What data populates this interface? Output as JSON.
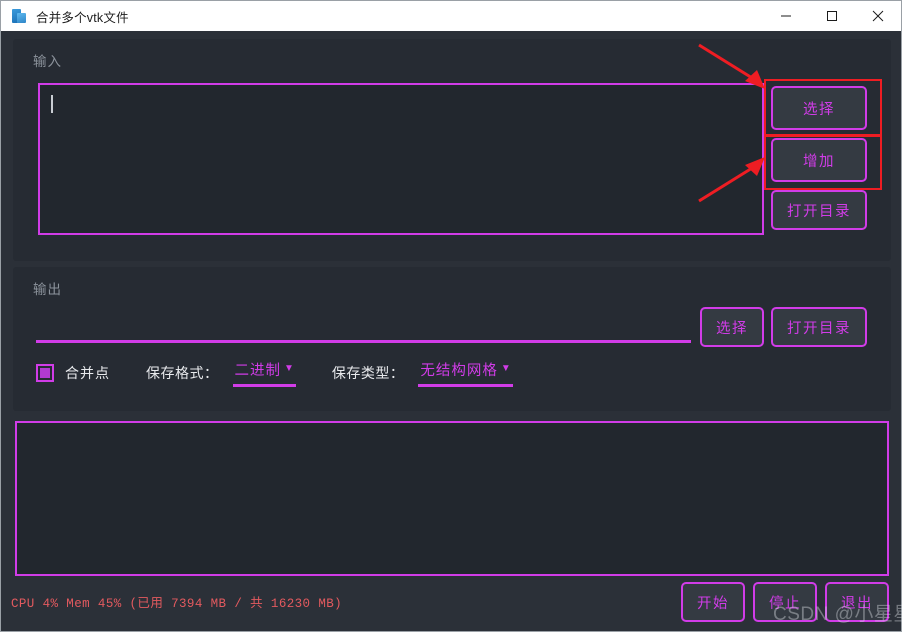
{
  "window": {
    "title": "合并多个vtk文件",
    "icon": "vtk-app-icon",
    "controls": {
      "minimize": "minimize-icon",
      "maximize": "maximize-icon",
      "close": "close-icon"
    }
  },
  "colors": {
    "accent": "#d13ce8",
    "annotation": "#ee1d23",
    "status_text": "#e35a5f",
    "panel_bg": "#262b33",
    "window_bg": "#2b3038",
    "field_bg": "#22272e"
  },
  "input_section": {
    "label": "输入",
    "textarea_value": "",
    "buttons": {
      "select": "选择",
      "add": "增加",
      "open_dir": "打开目录"
    }
  },
  "output_section": {
    "label": "输出",
    "path_value": "",
    "buttons": {
      "select": "选择",
      "open_dir": "打开目录"
    },
    "merge_points": {
      "label": "合并点",
      "checked": true
    },
    "save_format": {
      "label": "保存格式：",
      "value": "二进制",
      "arrow": "▼"
    },
    "save_type": {
      "label": "保存类型：",
      "value": "无结构网格",
      "arrow": "▼"
    }
  },
  "log_panel": {
    "content": ""
  },
  "status_bar": {
    "text": "CPU 4% Mem 45% (已用 7394 MB / 共 16230 MB)"
  },
  "action_buttons": {
    "start": "开始",
    "stop": "停止",
    "exit": "退出"
  },
  "watermark": {
    "text": "CSDN @小星星"
  }
}
